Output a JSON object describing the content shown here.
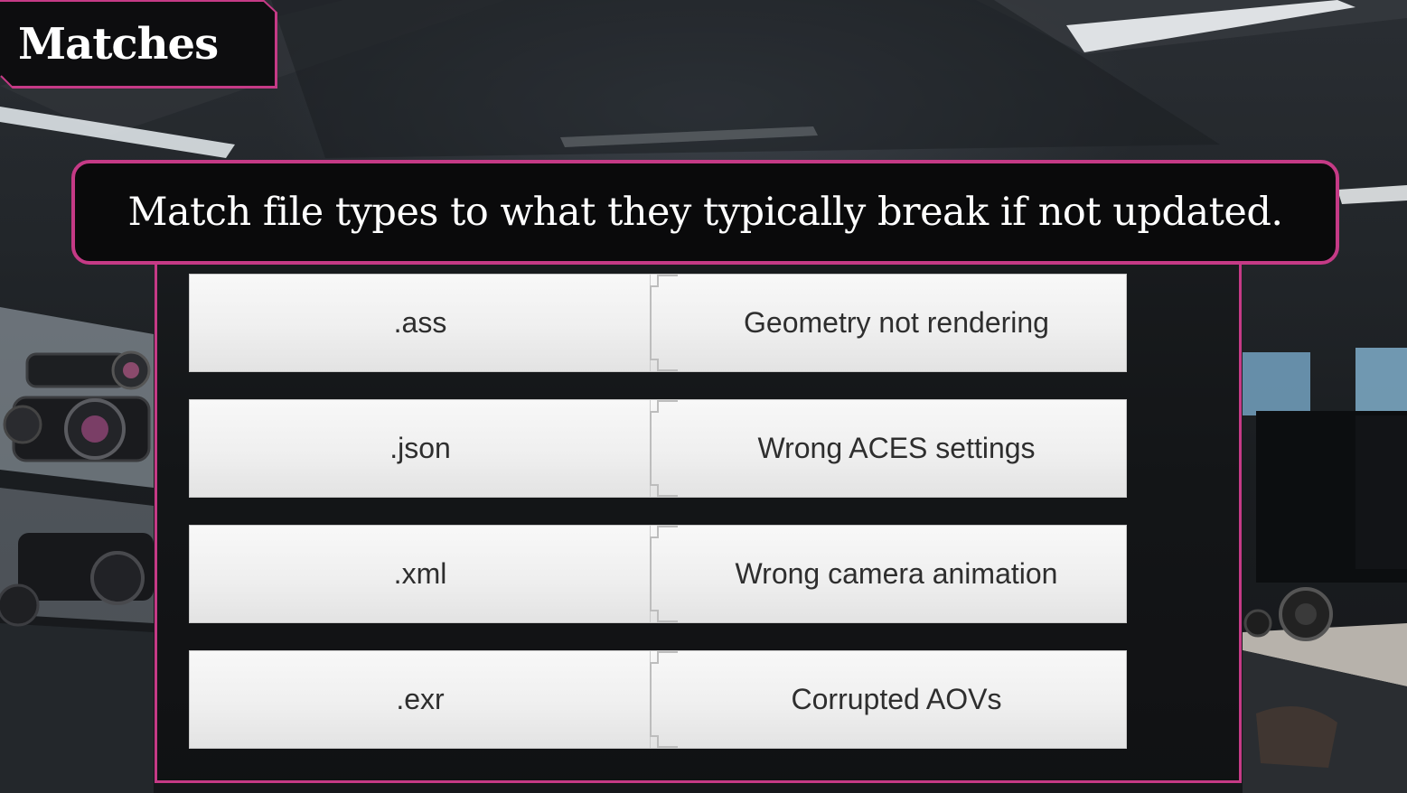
{
  "header": {
    "title": "Matches"
  },
  "question": {
    "text": "Match file types to what they typically break if not updated."
  },
  "pairs": [
    {
      "left": ".ass",
      "right": "Geometry not rendering"
    },
    {
      "left": ".json",
      "right": "Wrong ACES settings"
    },
    {
      "left": ".xml",
      "right": "Wrong camera animation"
    },
    {
      "left": ".exr",
      "right": "Corrupted AOVs"
    }
  ],
  "colors": {
    "accent": "#c53a86",
    "bar_background": "#0a0a0b",
    "card_top": "#f8f8f8",
    "card_bottom": "#e3e3e3",
    "card_text": "#2e2e2e"
  }
}
